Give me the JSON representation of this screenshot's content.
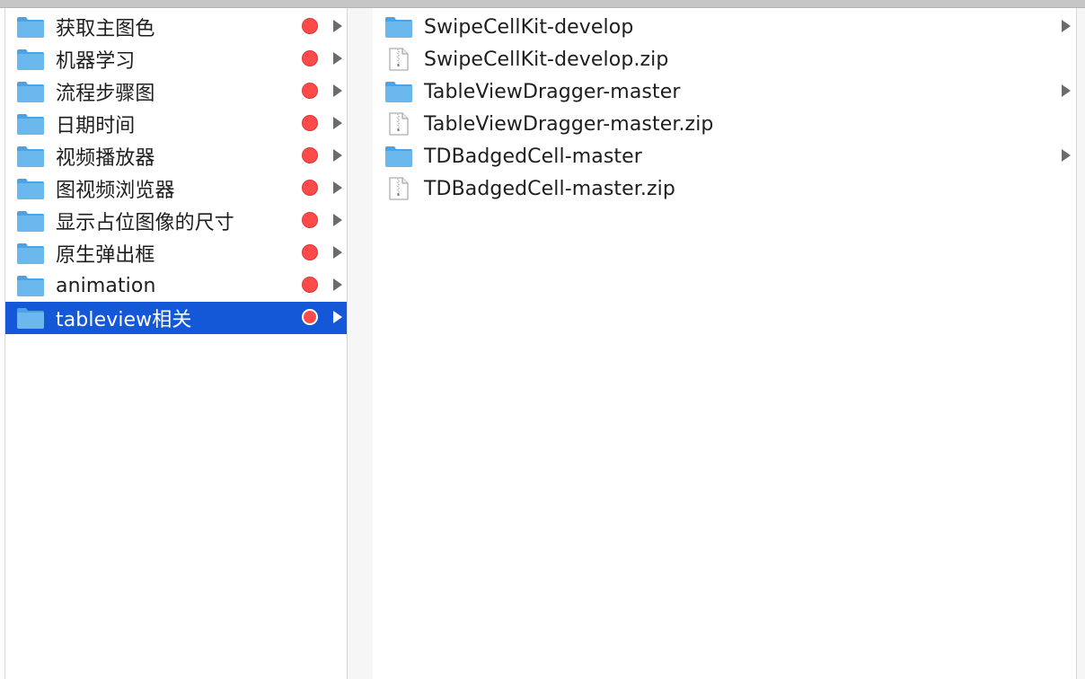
{
  "colors": {
    "selection": "#1458d8",
    "folder": "#6bb8ef",
    "tag_red": "#fe4a49"
  },
  "left_column": {
    "items": [
      {
        "label": "获取主图色",
        "icon": "folder-icon",
        "tag": "red",
        "has_children": true
      },
      {
        "label": "机器学习",
        "icon": "folder-icon",
        "tag": "red",
        "has_children": true
      },
      {
        "label": "流程步骤图",
        "icon": "folder-icon",
        "tag": "red",
        "has_children": true
      },
      {
        "label": "日期时间",
        "icon": "folder-icon",
        "tag": "red",
        "has_children": true
      },
      {
        "label": "视频播放器",
        "icon": "folder-icon",
        "tag": "red",
        "has_children": true
      },
      {
        "label": "图视频浏览器",
        "icon": "folder-icon",
        "tag": "red",
        "has_children": true
      },
      {
        "label": "显示占位图像的尺寸",
        "icon": "folder-icon",
        "tag": "red",
        "has_children": true
      },
      {
        "label": "原生弹出框",
        "icon": "folder-icon",
        "tag": "red",
        "has_children": true
      },
      {
        "label": "animation",
        "icon": "folder-icon",
        "tag": "red",
        "has_children": true
      },
      {
        "label": "tableview相关",
        "icon": "folder-icon",
        "tag": "red",
        "has_children": true,
        "selected": true
      }
    ]
  },
  "right_column": {
    "items": [
      {
        "label": "SwipeCellKit-develop",
        "icon": "folder-icon",
        "has_children": true
      },
      {
        "label": "SwipeCellKit-develop.zip",
        "icon": "zip-file-icon",
        "has_children": false
      },
      {
        "label": "TableViewDragger-master",
        "icon": "folder-icon",
        "has_children": true
      },
      {
        "label": "TableViewDragger-master.zip",
        "icon": "zip-file-icon",
        "has_children": false
      },
      {
        "label": "TDBadgedCell-master",
        "icon": "folder-icon",
        "has_children": true
      },
      {
        "label": "TDBadgedCell-master.zip",
        "icon": "zip-file-icon",
        "has_children": false
      }
    ]
  }
}
